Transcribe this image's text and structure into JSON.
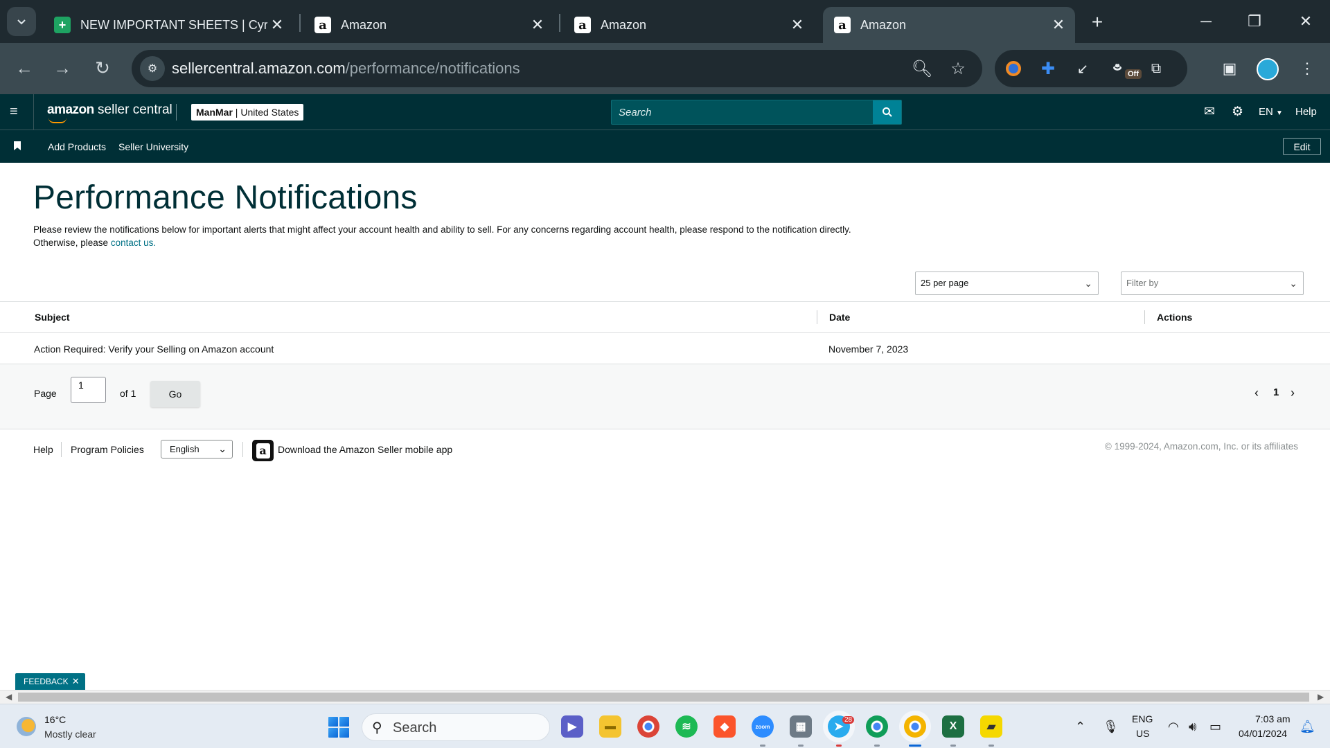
{
  "browser": {
    "tabs": [
      {
        "title": "NEW IMPORTANT SHEETS | Cyril -",
        "favicon": "google-sheets-icon",
        "active": false
      },
      {
        "title": "Amazon",
        "favicon": "amazon-icon",
        "active": false
      },
      {
        "title": "Amazon",
        "favicon": "amazon-icon",
        "active": false
      },
      {
        "title": "Amazon",
        "favicon": "amazon-icon",
        "active": true
      }
    ],
    "url_host": "sellercentral.amazon.com",
    "url_path": "/performance/notifications",
    "ext_off_badge": "Off"
  },
  "header": {
    "logo_brand": "amazon",
    "logo_rest": " seller central",
    "store_name": "ManMar",
    "store_sep": " | ",
    "store_region": "United States",
    "search_placeholder": "Search",
    "language": "EN",
    "help": "Help"
  },
  "subnav": {
    "links": [
      "Add Products",
      "Seller University"
    ],
    "edit": "Edit"
  },
  "page": {
    "title": "Performance Notifications",
    "description": "Please review the notifications below for important alerts that might affect your account health and ability to sell. For any concerns regarding account health, please respond to the notification directly.",
    "description2": "Otherwise, please ",
    "contact_link": "contact us.",
    "per_page": "25 per page",
    "filter_placeholder": "Filter by"
  },
  "table": {
    "columns": [
      "Subject",
      "Date",
      "Actions"
    ],
    "rows": [
      {
        "subject": "Action Required: Verify your Selling on Amazon account",
        "date": "November 7, 2023",
        "actions": ""
      }
    ]
  },
  "pager": {
    "page_label": "Page",
    "page_value": "1",
    "of_label": "of 1",
    "go": "Go",
    "current": "1"
  },
  "footer": {
    "help": "Help",
    "policies": "Program Policies",
    "language": "English",
    "app_text": "Download the Amazon Seller mobile app",
    "copyright": "© 1999-2024, Amazon.com, Inc. or its affiliates"
  },
  "feedback": "FEEDBACK",
  "taskbar": {
    "temp": "16°C",
    "weather": "Mostly clear",
    "search": "Search",
    "lang_line1": "ENG",
    "lang_line2": "US",
    "time": "7:03 am",
    "date": "04/01/2024",
    "telegram_badge": "28"
  },
  "colors": {
    "brand_dark": "#002f36",
    "link": "#007185",
    "search_button": "#008296",
    "browser_tabbar": "#1f2a30",
    "browser_toolbar": "#3b4a51"
  }
}
